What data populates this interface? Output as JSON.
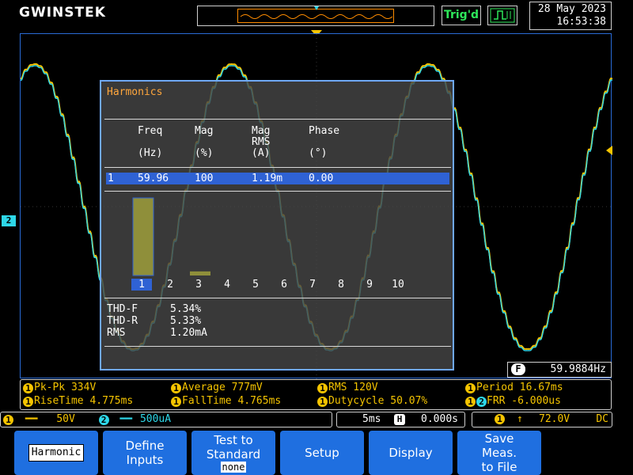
{
  "header": {
    "logo": "GWINSTEK",
    "trigger_status": "Trig'd",
    "date": "28 May 2023",
    "time": "16:53:38"
  },
  "harmonics": {
    "title": "Harmonics",
    "columns": [
      {
        "line1": "Freq",
        "line2": "",
        "unit": "(Hz)"
      },
      {
        "line1": "Mag",
        "line2": "",
        "unit": "(%)"
      },
      {
        "line1": "Mag",
        "line2": "RMS",
        "unit": "(A)"
      },
      {
        "line1": "Phase",
        "line2": "",
        "unit": "(°)"
      }
    ],
    "row": {
      "index": "1",
      "freq": "59.96",
      "mag": "100",
      "mag_rms": "1.19m",
      "phase": "0.00"
    },
    "bar_orders": [
      "1",
      "2",
      "3",
      "4",
      "5",
      "6",
      "7",
      "8",
      "9",
      "10"
    ],
    "bar_levels_pct": [
      100,
      0,
      5.3,
      0,
      0,
      0,
      0,
      0,
      0,
      0
    ],
    "selected_order": "1",
    "summary": [
      {
        "label": "THD-F",
        "value": "5.34%"
      },
      {
        "label": "THD-R",
        "value": "5.33%"
      },
      {
        "label": "RMS",
        "value": "1.20mA"
      }
    ]
  },
  "freq_readout": {
    "badge": "F",
    "value": "59.9884Hz"
  },
  "measurements": {
    "pk_pk": "Pk-Pk 334V",
    "average": "Average 777mV",
    "rms": "RMS 120V",
    "period": "Period 16.67ms",
    "rise_time": "RiseTime 4.775ms",
    "fall_time": "FallTime 4.765ms",
    "duty_cycle": "Dutycycle 50.07%",
    "frr": "FRR -6.000us"
  },
  "status": {
    "ch1_scale": "50V",
    "ch2_scale": "500uA",
    "timebase": "5ms",
    "position": "0.000s",
    "trigger_level": "72.0V",
    "coupling": "DC"
  },
  "softkeys": {
    "harmonic": "Harmonic",
    "define_inputs_1": "Define",
    "define_inputs_2": "Inputs",
    "test_standard_1": "Test to",
    "test_standard_2": "Standard",
    "test_standard_value": "none",
    "setup": "Setup",
    "display": "Display",
    "save_1": "Save",
    "save_2": "Meas.",
    "save_3": "to File"
  },
  "colors": {
    "ch1": "#f5c400",
    "ch2": "#2ed7e8",
    "accent": "#1f6fe0",
    "panel_title": "#ffa63c"
  }
}
